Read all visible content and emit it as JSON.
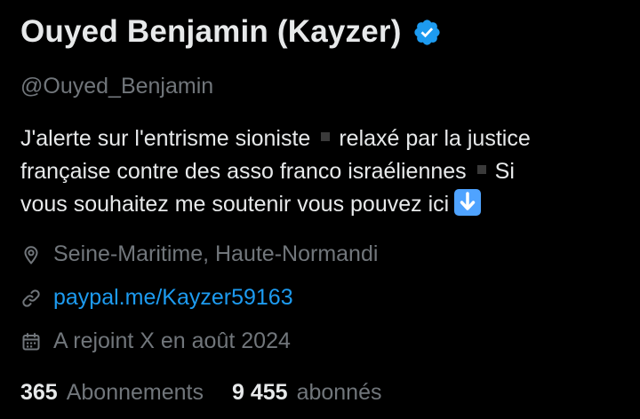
{
  "profile": {
    "display_name": "Ouyed Benjamin (Kayzer)",
    "verified_icon": "verified-badge-icon",
    "handle": "@Ouyed_Benjamin",
    "bio": {
      "line1_a": "J'alerte sur l'entrisme sioniste",
      "line1_b": "relaxé par la justice",
      "line2_a": "française contre des asso franco israéliennes",
      "line2_b": "Si",
      "line3": "vous souhaitez me soutenir vous pouvez ici",
      "separator_icon": "black-small-square-icon",
      "arrow_icon": "down-arrow-emoji-icon"
    },
    "location": "Seine-Maritime, Haute-Normandi",
    "link": "paypal.me/Kayzer59163",
    "joined": "A rejoint X en août 2024",
    "following_count": "365",
    "following_label": "Abonnements",
    "followers_count": "9 455",
    "followers_label": "abonnés"
  },
  "colors": {
    "background": "#000000",
    "primary_text": "#e7e9ea",
    "secondary_text": "#71767b",
    "link": "#1d9bf0",
    "verified": "#1d9bf0"
  }
}
